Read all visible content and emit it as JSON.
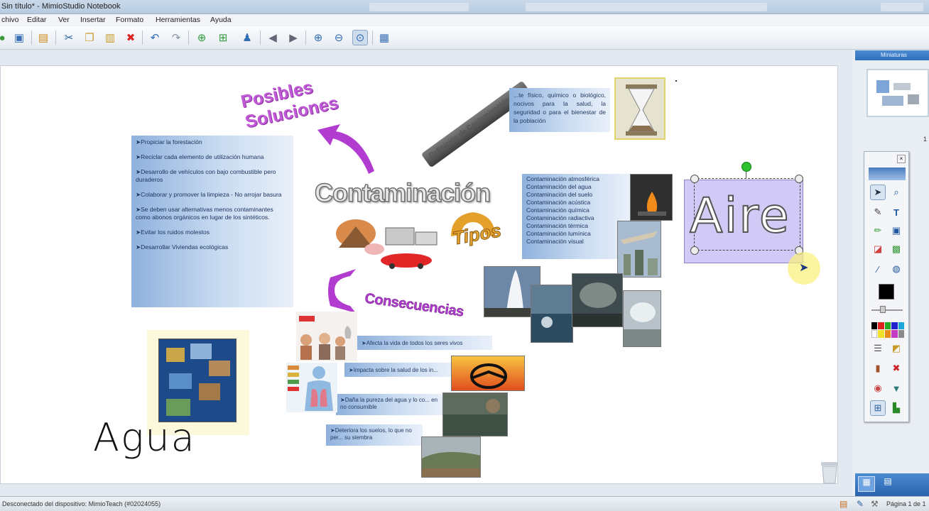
{
  "app": {
    "title": "Sin título* - MimioStudio Notebook"
  },
  "menu": [
    "chivo",
    "Editar",
    "Ver",
    "Insertar",
    "Formato",
    "Herramientas",
    "Ayuda"
  ],
  "thumbnails": {
    "title": "Miniaturas"
  },
  "status": {
    "text": "Desconectado del dispositivo: MimioTeach (#02024055)",
    "page": "Página 1 de 1"
  },
  "canvas": {
    "title": "Contaminación",
    "posibles": "Posibles\nSoluciones",
    "tipos": "Tipos",
    "consecuencias": "Consecuencias",
    "definicion_banner": "Definición de Contaminación",
    "definicion_text": "...te físico, químico o biológico, nocivos para la salud, la seguridad o para el bienestar de la población",
    "soluciones": [
      "➤Propiciar la forestación",
      "➤Reciclar cada elemento de utilización humana",
      "➤Desarrollo de vehículos con bajo combustible pero duraderos",
      "➤Colaborar y promover la limpieza - No arrojar basura",
      "➤Se deben usar alternativas menos contaminantes como abonos orgánicos en lugar de los sintéticos.",
      "➤Evitar los ruidos molestos",
      "➤Desarrollar Viviendas ecológicas"
    ],
    "tipos_list": [
      "Contaminación atmosférica",
      "Contaminación del agua",
      "Contaminación del suelo",
      "Contaminación acústica",
      "Contaminación química",
      "Contaminación radiactiva",
      "Contaminación térmica",
      "Contaminación lumínica",
      "Contaminación visual"
    ],
    "consecuencias_list": [
      "➤Afecta la vida de todos los seres vivos",
      "➤Impacta sobre la salud de los in...",
      "➤Daña la pureza del agua y lo co... en no consumible",
      "➤Deteriora los suelos, lo que no per... su siembra"
    ],
    "aire": "Aire",
    "agua": "Agua"
  },
  "colors": {
    "purple": "#b23bd0",
    "blue_box": "#8fb1dd",
    "accent": "#2e6fbd"
  }
}
